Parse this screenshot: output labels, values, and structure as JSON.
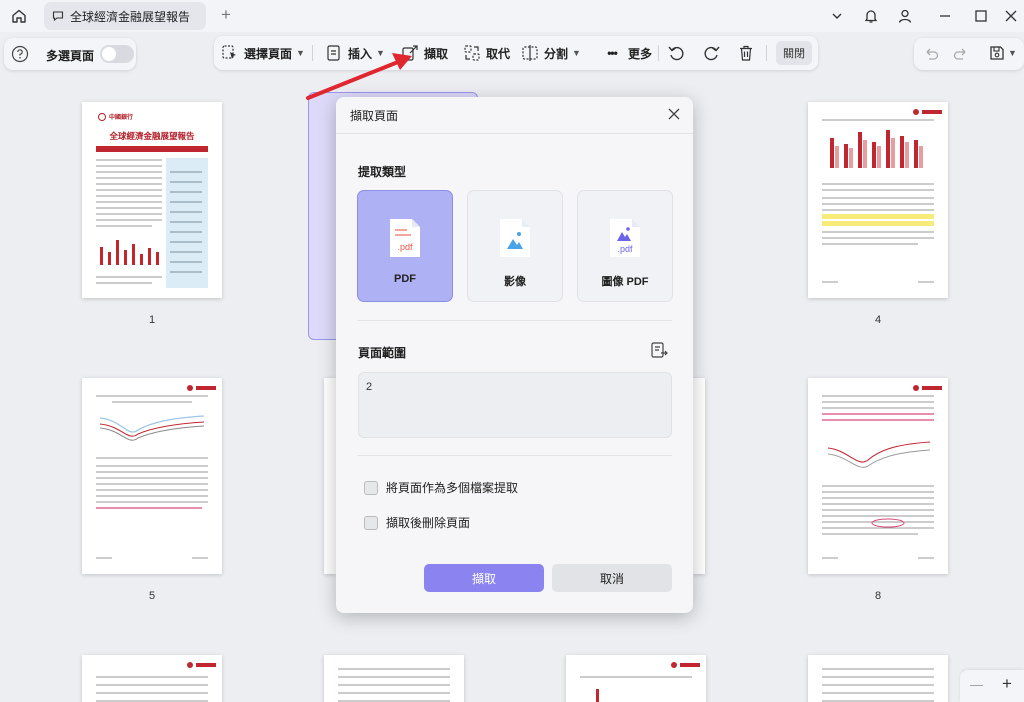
{
  "titlebar": {
    "tab_title": "全球經濟金融展望報告",
    "add_tab": "+"
  },
  "toolbar": {
    "multi_select_label": "多選頁面",
    "select_pages_label": "選擇頁面",
    "insert_label": "插入",
    "extract_label": "擷取",
    "replace_label": "取代",
    "split_label": "分割",
    "more_label": "更多",
    "close_label": "關閉",
    "more_glyph": "•••"
  },
  "thumbnails": [
    {
      "label": "1"
    },
    {
      "label": "4"
    },
    {
      "label": "5"
    },
    {
      "label": "8"
    }
  ],
  "thumb1": {
    "doc_title": "全球經濟金融展望報告",
    "logo_text": "中國銀行"
  },
  "dialog": {
    "title": "擷取頁面",
    "extract_type_heading": "提取類型",
    "types": [
      {
        "label": "PDF",
        "ext": ".pdf",
        "selected": true
      },
      {
        "label": "影像",
        "ext": "",
        "selected": false
      },
      {
        "label": "圖像 PDF",
        "ext": ".pdf",
        "selected": false
      }
    ],
    "page_range_heading": "頁面範圍",
    "page_range_value": "2",
    "option_separate_files": "將頁面作為多個檔案提取",
    "option_delete_after": "擷取後刪除頁面",
    "extract_button": "擷取",
    "cancel_button": "取消"
  },
  "zoom": {
    "minus": "—",
    "plus": "+"
  },
  "colors": {
    "accent": "#8b84f0",
    "selected_card": "#aeb1f3",
    "arrow": "#e0262e"
  }
}
